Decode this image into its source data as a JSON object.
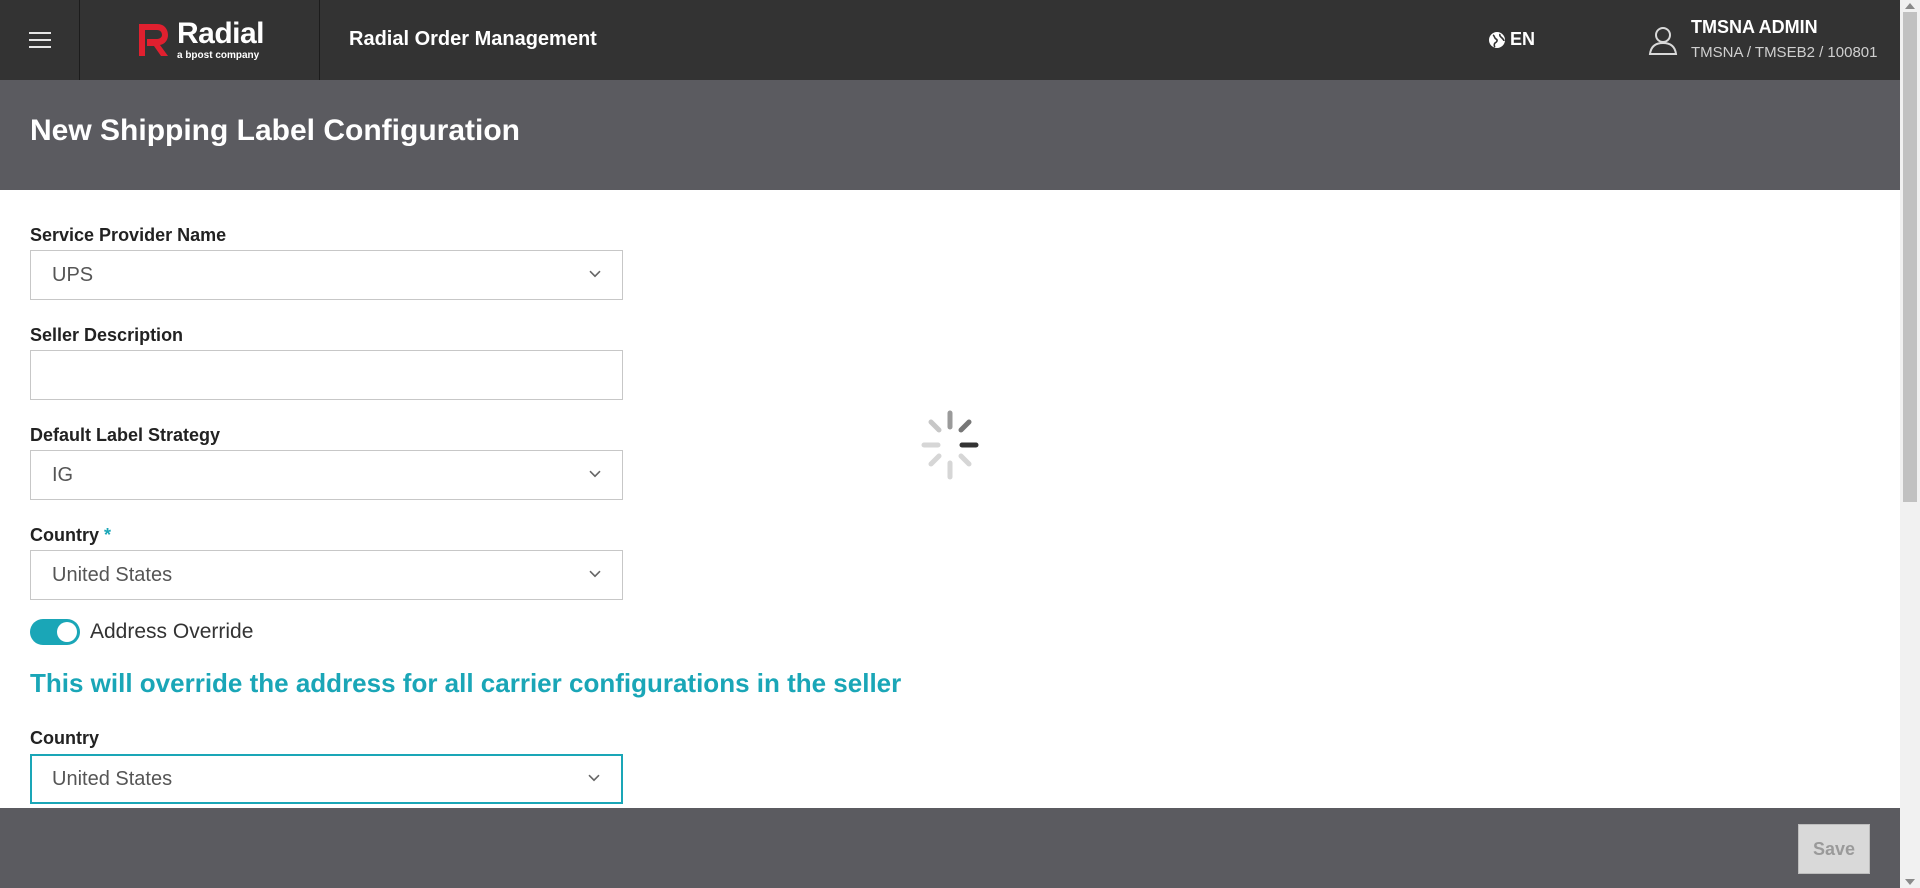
{
  "header": {
    "logo_name": "Radial",
    "logo_tagline": "a bpost company",
    "app_title": "Radial Order Management",
    "language": "EN",
    "user_name": "TMSNA ADMIN",
    "user_context": "TMSNA / TMSEB2 / 100801",
    "icons": {
      "menu": "hamburger-icon",
      "language": "globe-icon",
      "user": "user-icon"
    }
  },
  "page": {
    "title": "New Shipping Label Configuration"
  },
  "form": {
    "service_provider": {
      "label": "Service Provider Name",
      "value": "UPS"
    },
    "seller_description": {
      "label": "Seller Description",
      "value": ""
    },
    "default_label_strategy": {
      "label": "Default Label Strategy",
      "value": "IG"
    },
    "country": {
      "label": "Country",
      "required_marker": "*",
      "value": "United States"
    },
    "address_override": {
      "label": "Address Override",
      "enabled": true
    },
    "override_note": "This will override the address for all carrier configurations in the seller",
    "override_country": {
      "label": "Country",
      "value": "United States"
    }
  },
  "footer": {
    "save_label": "Save"
  },
  "colors": {
    "accent": "#1aa6b7",
    "brand_red": "#e0202f",
    "topbar": "#333333",
    "header": "#5b5b60"
  }
}
